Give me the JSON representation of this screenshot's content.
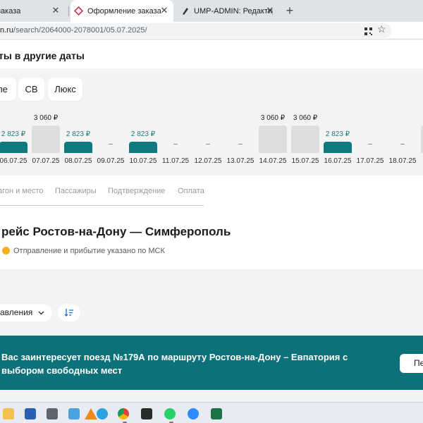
{
  "browser": {
    "tabs": [
      {
        "label": "заказа",
        "active": false
      },
      {
        "label": "Оформление заказа",
        "active": true
      },
      {
        "label": "UMP-ADMIN: Редактирование",
        "active": false
      }
    ],
    "url_prefix": "n.ru",
    "url_path": "/search/2064000-2078001/05.07.2025/"
  },
  "dates_section": {
    "title": "ты в другие даты",
    "car_types": [
      "ле",
      "СВ",
      "Люкс"
    ],
    "days": [
      {
        "date": "06.07.25",
        "price": "2 823 ₽",
        "state": "available"
      },
      {
        "date": "07.07.25",
        "price": "3 060 ₽",
        "state": "grey"
      },
      {
        "date": "08.07.25",
        "price": "2 823 ₽",
        "state": "available"
      },
      {
        "date": "09.07.25",
        "price": "–",
        "state": "none"
      },
      {
        "date": "10.07.25",
        "price": "2 823 ₽",
        "state": "available"
      },
      {
        "date": "11.07.25",
        "price": "–",
        "state": "none"
      },
      {
        "date": "12.07.25",
        "price": "–",
        "state": "none"
      },
      {
        "date": "13.07.25",
        "price": "–",
        "state": "none"
      },
      {
        "date": "14.07.25",
        "price": "3 060 ₽",
        "state": "grey"
      },
      {
        "date": "15.07.25",
        "price": "3 060 ₽",
        "state": "grey"
      },
      {
        "date": "16.07.25",
        "price": "2 823 ₽",
        "state": "available"
      },
      {
        "date": "17.07.25",
        "price": "–",
        "state": "none"
      },
      {
        "date": "18.07.25",
        "price": "–",
        "state": "none"
      }
    ]
  },
  "steps": [
    "агон и место",
    "Пассажиры",
    "Подтверждение",
    "Оплата"
  ],
  "route": {
    "title": "рейс Ростов-на-Дону — Симферополь",
    "note": "Отправление и прибытие указано по МСК"
  },
  "sort": {
    "label": "авления"
  },
  "banner": {
    "text": "Вас заинтересует поезд №179А по маршруту Ростов-на-Дону – Евпатория с выбором свободных мест",
    "button": "Пе"
  },
  "colors": {
    "accent": "#0e7a80",
    "banner": "#0d7179",
    "info": "#f2b11c"
  }
}
